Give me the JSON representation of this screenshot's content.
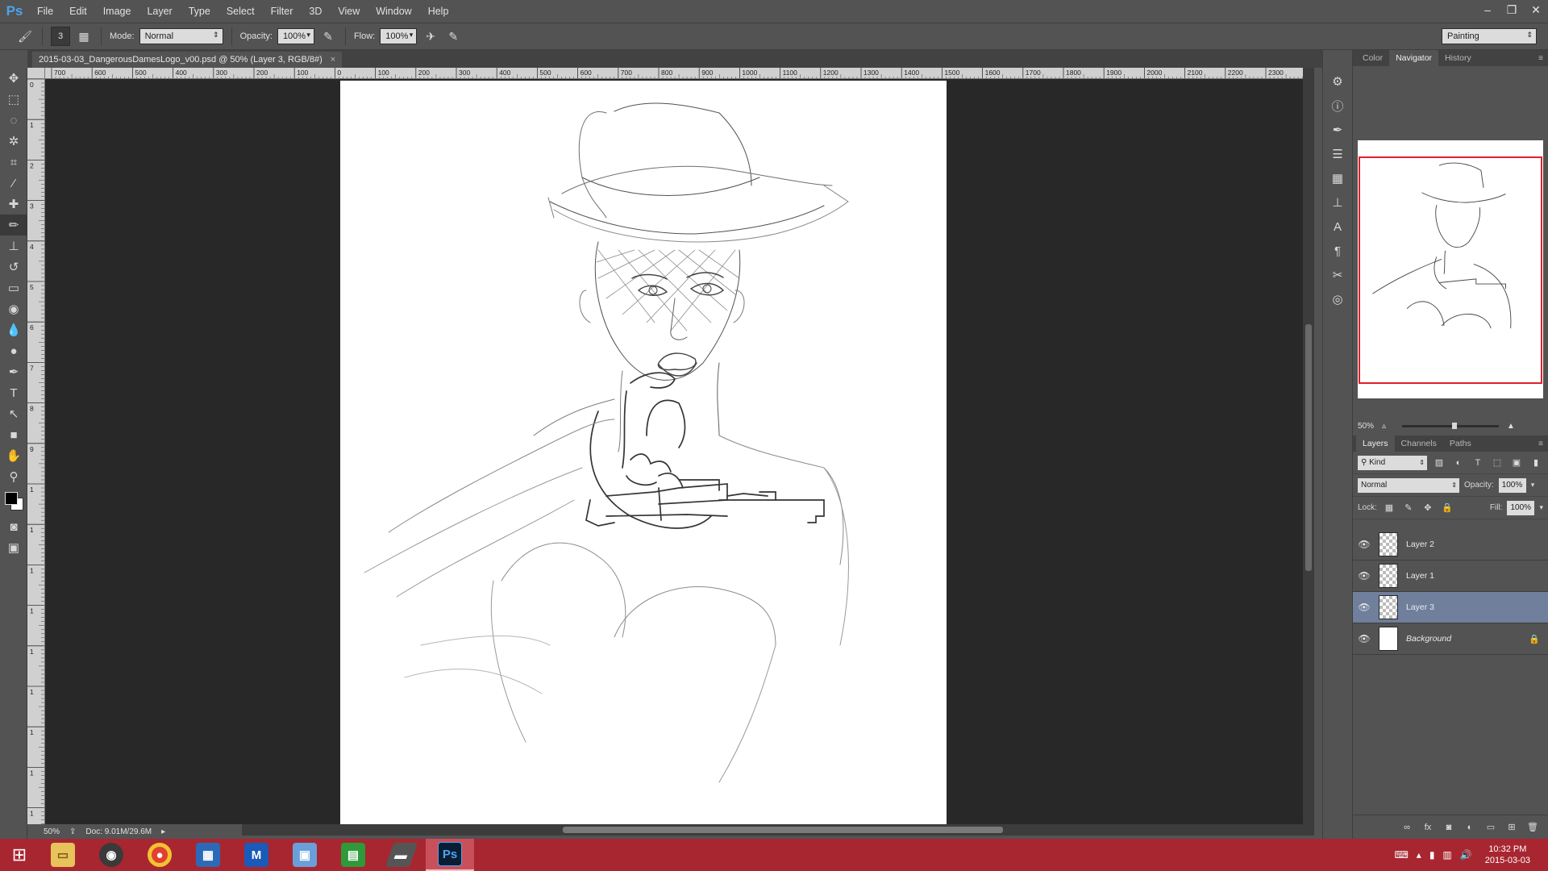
{
  "app": {
    "logo": "Ps"
  },
  "menu": [
    "File",
    "Edit",
    "Image",
    "Layer",
    "Type",
    "Select",
    "Filter",
    "3D",
    "View",
    "Window",
    "Help"
  ],
  "window_controls": {
    "minimize": "–",
    "restore": "❐",
    "close": "✕"
  },
  "options": {
    "brush_size": "3",
    "mode_label": "Mode:",
    "mode_value": "Normal",
    "opacity_label": "Opacity:",
    "opacity_value": "100%",
    "flow_label": "Flow:",
    "flow_value": "100%",
    "workspace": "Painting"
  },
  "document": {
    "tab_title": "2015-03-03_DangerousDamesLogo_v00.psd @ 50% (Layer 3, RGB/8#)",
    "close": "×"
  },
  "ruler": {
    "top_labels": [
      "700",
      "600",
      "500",
      "400",
      "300",
      "200",
      "100",
      "0",
      "100",
      "200",
      "300",
      "400",
      "500",
      "600",
      "700",
      "800",
      "900",
      "1000",
      "1100",
      "1200",
      "1300",
      "1400",
      "1500",
      "1600",
      "1700",
      "1800",
      "1900",
      "2000",
      "2100",
      "2200",
      "2300"
    ],
    "left_labels": [
      "0",
      "1",
      "2",
      "3",
      "4",
      "5",
      "6",
      "7",
      "8",
      "9",
      "1",
      "1",
      "1",
      "1",
      "1",
      "1",
      "1",
      "1",
      "1"
    ]
  },
  "status": {
    "zoom": "50%",
    "doc": "Doc: 9.01M/29.6M"
  },
  "panels": {
    "top_tabs": [
      "Color",
      "Navigator",
      "History"
    ],
    "top_active": "Navigator",
    "nav_zoom": "50%",
    "layer_tabs": [
      "Layers",
      "Channels",
      "Paths"
    ],
    "layers_active": "Layers",
    "filter_kind": "Kind",
    "blend_mode": "Normal",
    "opacity_label": "Opacity:",
    "opacity_value": "100%",
    "lock_label": "Lock:",
    "fill_label": "Fill:",
    "fill_value": "100%",
    "layers": [
      {
        "name": "Layer 2",
        "selected": false
      },
      {
        "name": "Layer 1",
        "selected": false
      },
      {
        "name": "Layer 3",
        "selected": true
      },
      {
        "name": "Background",
        "selected": false
      }
    ]
  },
  "colors": {
    "foreground": "#000000",
    "background": "#ffffff",
    "accent": "#6f7f9c",
    "taskbar": "#a82630",
    "nav_box": "#e0202a"
  },
  "taskbar": {
    "apps": [
      "file-explorer",
      "media-player",
      "chrome",
      "control-panel",
      "malwarebytes",
      "network-manager",
      "calculator",
      "tablet-app",
      "photoshop"
    ],
    "photoshop_label": "Ps",
    "time": "10:32 PM",
    "date": "2015-03-03"
  }
}
